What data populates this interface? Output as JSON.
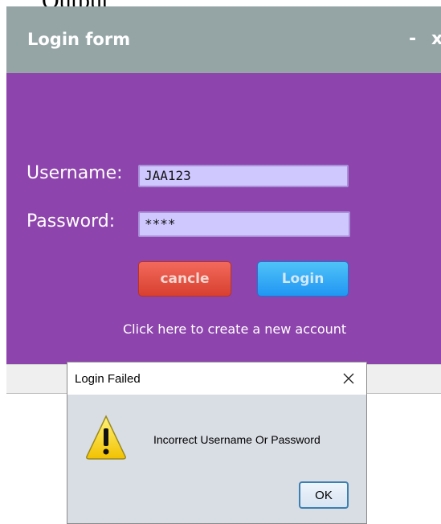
{
  "page": {
    "fragment_text": "Output"
  },
  "window": {
    "title": "Login form",
    "minimize_label": "-",
    "close_label": "x"
  },
  "form": {
    "username_label": "Username:",
    "username_value": "JAA123",
    "password_label": "Password:",
    "password_value": "****",
    "cancel_label": "cancle",
    "login_label": "Login",
    "create_account_link": "Click here to create a new account"
  },
  "dialog": {
    "title": "Login Failed",
    "message": "Incorrect Username Or Password",
    "ok_label": "OK",
    "icon": "warning-icon"
  },
  "colors": {
    "titlebar": "#95a5a6",
    "form_background": "#8e44ad",
    "field_background": "#cfc8ff",
    "cancel_button": "#e74c3c",
    "login_button": "#2d9cf0"
  }
}
